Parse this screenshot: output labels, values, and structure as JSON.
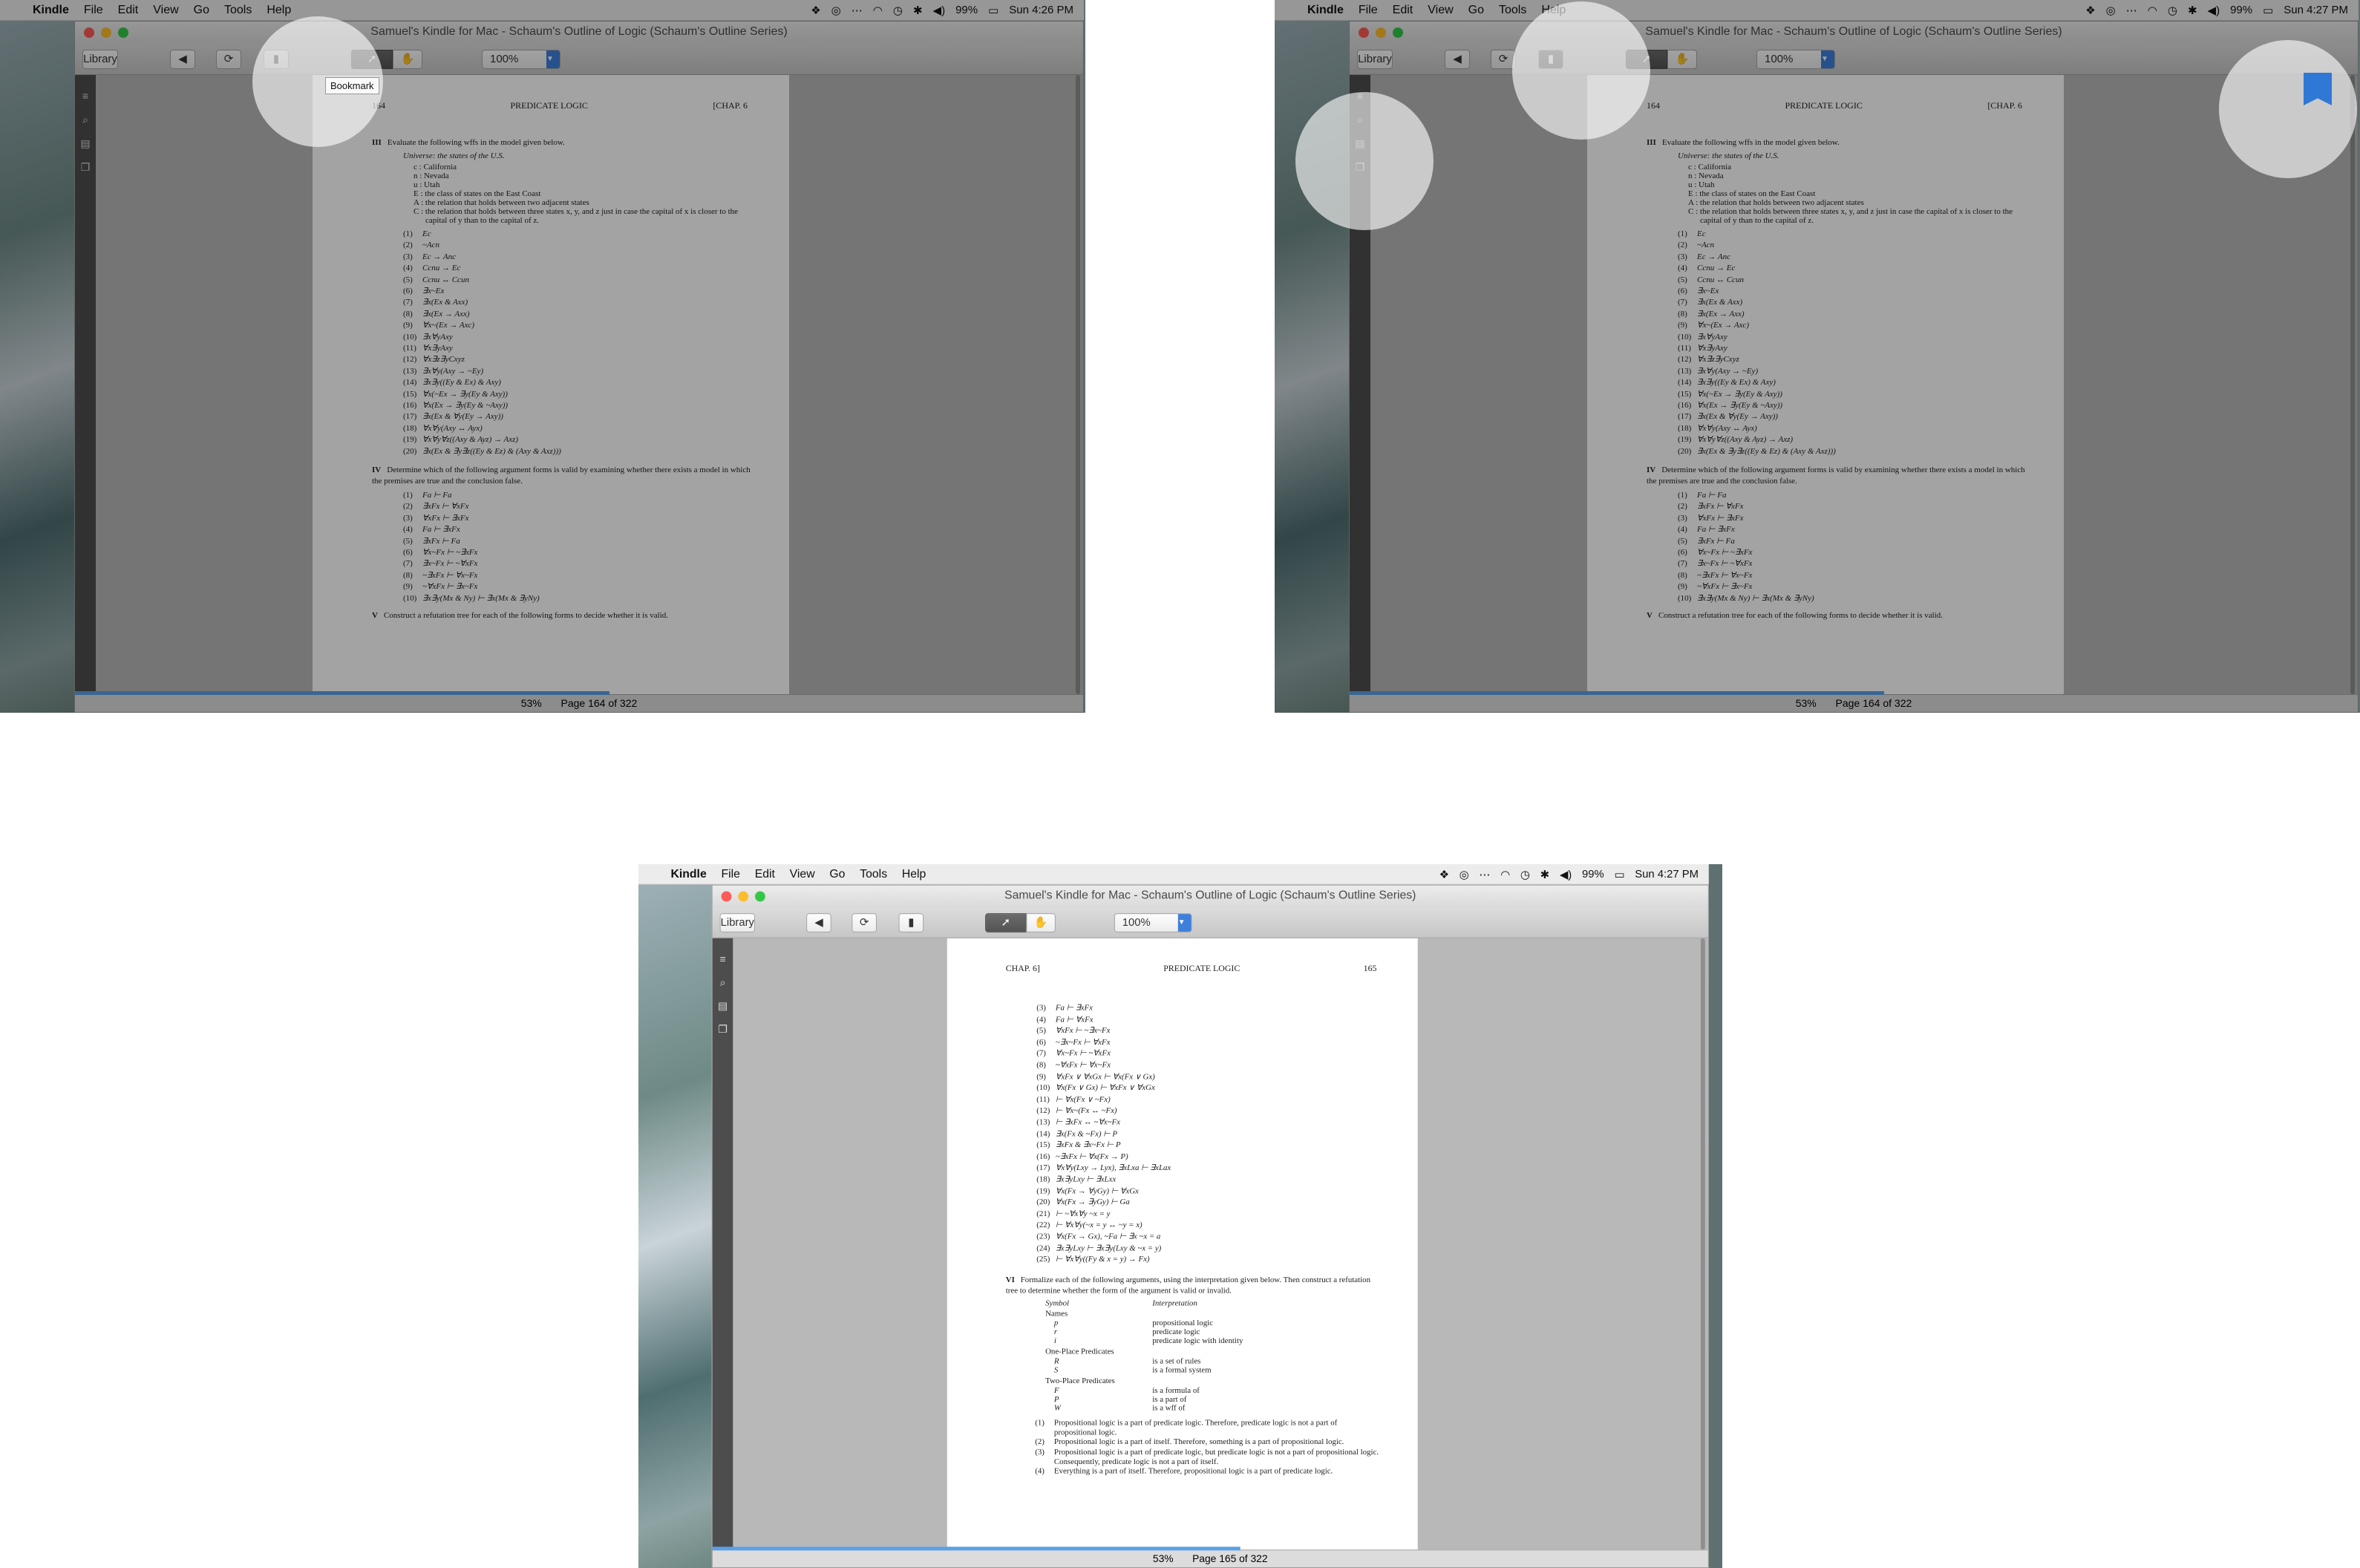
{
  "menubar": {
    "app": "Kindle",
    "items": [
      "File",
      "Edit",
      "View",
      "Go",
      "Tools",
      "Help"
    ],
    "battery": "99%",
    "times": [
      "Sun 4:26 PM",
      "Sun 4:27 PM",
      "Sun 4:27 PM"
    ]
  },
  "window": {
    "title": "Samuel's Kindle for Mac - Schaum's Outline of Logic (Schaum's Outline Series)",
    "library": "Library",
    "zoom": "100%"
  },
  "screens": [
    {
      "status": {
        "percent": "53%",
        "page": "Page 164 of 322",
        "progress": 0.53
      },
      "tooltip": "Bookmark"
    },
    {
      "status": {
        "percent": "53%",
        "page": "Page 164 of 322",
        "progress": 0.53
      },
      "bookmark_added": true
    },
    {
      "status": {
        "percent": "53%",
        "page": "Page 165 of 322",
        "progress": 0.53
      }
    }
  ],
  "page164": {
    "head": {
      "left": "164",
      "center": "PREDICATE LOGIC",
      "right": "[CHAP. 6"
    },
    "sec3": {
      "num": "III",
      "text": "Evaluate the following wffs in the model given below."
    },
    "universe": "Universe: the states of the U.S.",
    "defs": [
      "c : California",
      "n : Nevada",
      "u : Utah",
      "E : the class of states on the East Coast",
      "A : the relation that holds between two adjacent states",
      "C : the relation that holds between three states x, y, and z just in case the capital of x is closer to the",
      "capital of y than to the capital of z."
    ],
    "items": [
      [
        "(1)",
        "Ec"
      ],
      [
        "(2)",
        "~Acn"
      ],
      [
        "(3)",
        "Ec → Anc"
      ],
      [
        "(4)",
        "Ccnu → Ec"
      ],
      [
        "(5)",
        "Ccnu ↔ Ccun"
      ],
      [
        "(6)",
        "∃x~Ex"
      ],
      [
        "(7)",
        "∃x(Ex & Axx)"
      ],
      [
        "(8)",
        "∃x(Ex → Axx)"
      ],
      [
        "(9)",
        "∀x~(Ex → Axc)"
      ],
      [
        "(10)",
        "∃x∀yAxy"
      ],
      [
        "(11)",
        "∀x∃yAxy"
      ],
      [
        "(12)",
        "∀x∃z∃yCxyz"
      ],
      [
        "(13)",
        "∃x∀y(Axy → ~Ey)"
      ],
      [
        "(14)",
        "∃x∃y((Ey & Ex) & Axy)"
      ],
      [
        "(15)",
        "∀x(~Ex → ∃y(Ey & Axy))"
      ],
      [
        "(16)",
        "∀x(Ex → ∃y(Ey & ~Axy))"
      ],
      [
        "(17)",
        "∃x(Ex & ∀y(Ey → Axy))"
      ],
      [
        "(18)",
        "∀x∀y(Axy ↔ Ayx)"
      ],
      [
        "(19)",
        "∀x∀y∀z((Axy & Ayz) → Axz)"
      ],
      [
        "(20)",
        "∃x(Ex & ∃y∃z((Ey & Ez) & (Axy & Axz)))"
      ]
    ],
    "sec4": {
      "num": "IV",
      "text": "Determine which of the following argument forms is valid by examining whether there exists a model in which the premises are true and the conclusion false."
    },
    "items4": [
      [
        "(1)",
        "Fa ⊢ Fa"
      ],
      [
        "(2)",
        "∃xFx ⊢ ∀xFx"
      ],
      [
        "(3)",
        "∀xFx ⊢ ∃xFx"
      ],
      [
        "(4)",
        "Fa ⊢ ∃xFx"
      ],
      [
        "(5)",
        "∃xFx ⊢ Fa"
      ],
      [
        "(6)",
        "∀x~Fx ⊢ ~∃xFx"
      ],
      [
        "(7)",
        "∃x~Fx ⊢ ~∀xFx"
      ],
      [
        "(8)",
        "~∃xFx ⊢ ∀x~Fx"
      ],
      [
        "(9)",
        "~∀xFx ⊢ ∃x~Fx"
      ],
      [
        "(10)",
        "∃x∃y(Mx & Ny) ⊢ ∃x(Mx & ∃yNy)"
      ]
    ],
    "sec5": {
      "num": "V",
      "text": "Construct a refutation tree for each of the following forms to decide whether it is valid."
    }
  },
  "page165": {
    "head": {
      "left": "CHAP. 6]",
      "center": "PREDICATE LOGIC",
      "right": "165"
    },
    "items": [
      [
        "(3)",
        "Fa ⊢ ∃xFx"
      ],
      [
        "(4)",
        "Fa ⊢ ∀xFx"
      ],
      [
        "(5)",
        "∀xFx ⊢ ~∃x~Fx"
      ],
      [
        "(6)",
        "~∃x~Fx ⊢ ∀xFx"
      ],
      [
        "(7)",
        "∀x~Fx ⊢ ~∀xFx"
      ],
      [
        "(8)",
        "~∀xFx ⊢ ∀x~Fx"
      ],
      [
        "(9)",
        "∀xFx ∨ ∀xGx ⊢ ∀x(Fx ∨ Gx)"
      ],
      [
        "(10)",
        "∀x(Fx ∨ Gx) ⊢ ∀xFx ∨ ∀xGx"
      ],
      [
        "(11)",
        "⊢ ∀x(Fx ∨ ~Fx)"
      ],
      [
        "(12)",
        "⊢ ∀x~(Fx ↔ ~Fx)"
      ],
      [
        "(13)",
        "⊢ ∃xFx ↔ ~∀x~Fx"
      ],
      [
        "(14)",
        "∃x(Fx & ~Fx) ⊢ P"
      ],
      [
        "(15)",
        "∃xFx & ∃x~Fx ⊢ P"
      ],
      [
        "(16)",
        "~∃xFx ⊢ ∀x(Fx → P)"
      ],
      [
        "(17)",
        "∀x∀y(Lxy → Lyx), ∃xLxa ⊢ ∃xLax"
      ],
      [
        "(18)",
        "∃x∃yLxy ⊢ ∃xLxx"
      ],
      [
        "(19)",
        "∀x(Fx → ∀yGy) ⊢ ∀xGx"
      ],
      [
        "(20)",
        "∀x(Fx → ∃yGy) ⊢ Ga"
      ],
      [
        "(21)",
        "⊢ ~∀x∀y ~x = y"
      ],
      [
        "(22)",
        "⊢ ∀x∀y(~x = y ↔ ~y = x)"
      ],
      [
        "(23)",
        "∀x(Fx → Gx), ~Fa ⊢ ∃x ~x = a"
      ],
      [
        "(24)",
        "∃x∃yLxy ⊢ ∃x∃y(Lxy & ~x = y)"
      ],
      [
        "(25)",
        "⊢ ∀x∀y((Fy & x = y) → Fx)"
      ]
    ],
    "sec6": {
      "num": "VI",
      "text": "Formalize each of the following arguments, using the interpretation given below. Then construct a refutation tree to determine whether the form of the argument is valid or invalid."
    },
    "table_header": {
      "symbol": "Symbol",
      "interp": "Interpretation"
    },
    "names_label": "Names",
    "names": [
      [
        "p",
        "propositional logic"
      ],
      [
        "r",
        "predicate logic"
      ],
      [
        "i",
        "predicate logic with identity"
      ]
    ],
    "one_label": "One-Place Predicates",
    "one": [
      [
        "R",
        "is a set of rules"
      ],
      [
        "S",
        "is a formal system"
      ]
    ],
    "two_label": "Two-Place Predicates",
    "two": [
      [
        "F",
        "is a formula of"
      ],
      [
        "P",
        "is a part of"
      ],
      [
        "W",
        "is a wff of"
      ]
    ],
    "args": [
      [
        "(1)",
        "Propositional logic is a part of predicate logic. Therefore, predicate logic is not a part of propositional logic."
      ],
      [
        "(2)",
        "Propositional logic is a part of itself. Therefore, something is a part of propositional logic."
      ],
      [
        "(3)",
        "Propositional logic is a part of predicate logic, but predicate logic is not a part of propositional logic. Consequently, predicate logic is not a part of itself."
      ],
      [
        "(4)",
        "Everything is a part of itself. Therefore, propositional logic is a part of predicate logic."
      ]
    ]
  }
}
